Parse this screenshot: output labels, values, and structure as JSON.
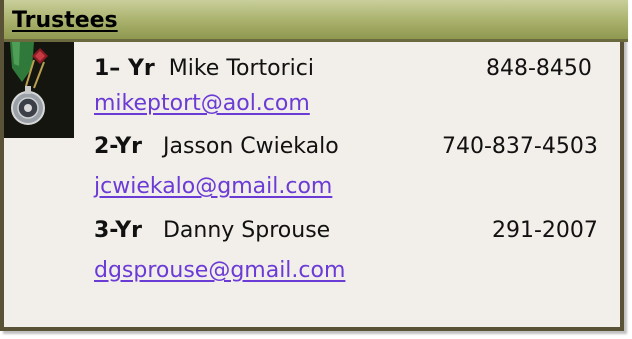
{
  "title": "Trustees",
  "trustees": [
    {
      "term": "1– Yr",
      "name": "Mike Tortorici",
      "phone": "848-8450",
      "email": "mikeptort@aol.com"
    },
    {
      "term": "2-Yr",
      "name": "Jasson Cwiekalo",
      "phone": "740-837-4503",
      "email": "jcwiekalo@gmail.com"
    },
    {
      "term": "3-Yr",
      "name": "Danny Sprouse",
      "phone": "291-2007",
      "email": "dgsprouse@gmail.com"
    }
  ],
  "colors": {
    "header": "#a8b06b",
    "panel": "#f2eee9",
    "border": "#5a5237",
    "link": "#6b3bd6"
  },
  "icons": {
    "medal": "medal-emblem-icon"
  }
}
